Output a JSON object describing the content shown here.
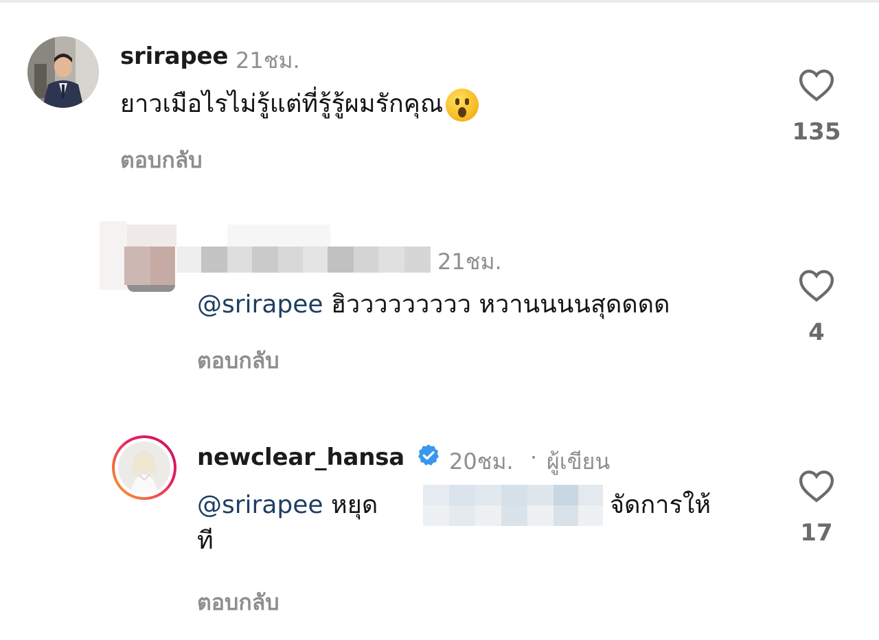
{
  "comments": [
    {
      "username": "srirapee",
      "time": "21ชม.",
      "text": "ยาวเมือไรไม่รู้แต่ที่รู้รู้ผมรักคุณ",
      "emoji": "astonished-face-emoji",
      "reply_label": "ตอบกลับ",
      "likes": "135"
    },
    {
      "username": "",
      "time": "21ชม.",
      "mention": "@srirapee",
      "text": "ฮิววววววววว หวานนนนสุดดดด",
      "reply_label": "ตอบกลับ",
      "likes": "4"
    },
    {
      "username": "newclear_hansa",
      "verified": true,
      "time": "20ชม.",
      "separator": "·",
      "author_label": "ผู้เขียน",
      "mention": "@srirapee",
      "text_before": "หยุด",
      "text_after": "จัดการให้",
      "text_wrap": "ที",
      "reply_label": "ตอบกลับ",
      "likes": "17"
    }
  ],
  "colors": {
    "mention": "#1f3e63",
    "muted": "#8e8e8e",
    "verified": "#3897f0",
    "story_ring_start": "#f9a825",
    "story_ring_end": "#c2185b"
  },
  "icons": [
    "heart-outline-icon",
    "verified-badge-icon"
  ]
}
